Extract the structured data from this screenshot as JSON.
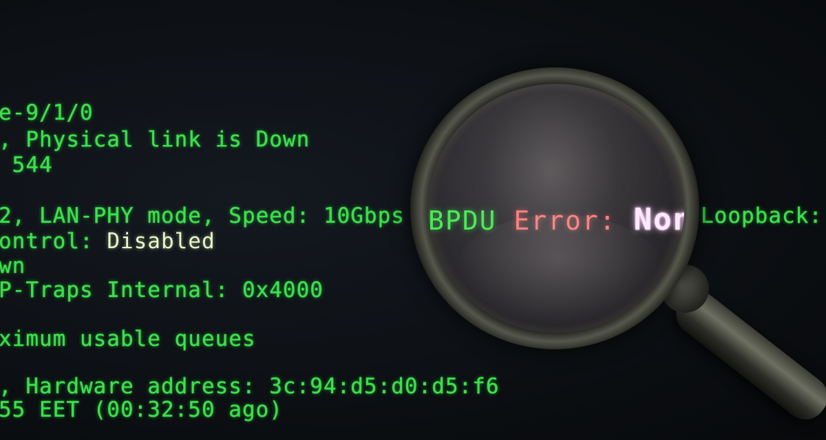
{
  "terminal": {
    "lines": [
      "e-9/1/0",
      ", Physical link is Down",
      " 544",
      "2, LAN-PHY mode, Speed: 10Gbps",
      "ontrol: ",
      "wn",
      "P-Traps Internal: 0x4000",
      "ximum usable queues",
      ", Hardware address: 3c:94:d5:d0:d5:f6",
      "55 EET (00:32:50 ago)"
    ],
    "highlight_value": "Disabled",
    "loopback_label": "Loopback:"
  },
  "magnifier": {
    "text_pdu": "BPDU",
    "text_error": "Error:",
    "text_non": "Non"
  },
  "colors": {
    "terminal_green": "#3be04a",
    "error_red": "#ff7f7f",
    "highlight_white": "#e6f6c8"
  },
  "icons": {
    "magnifier": "magnifying-glass-icon"
  }
}
